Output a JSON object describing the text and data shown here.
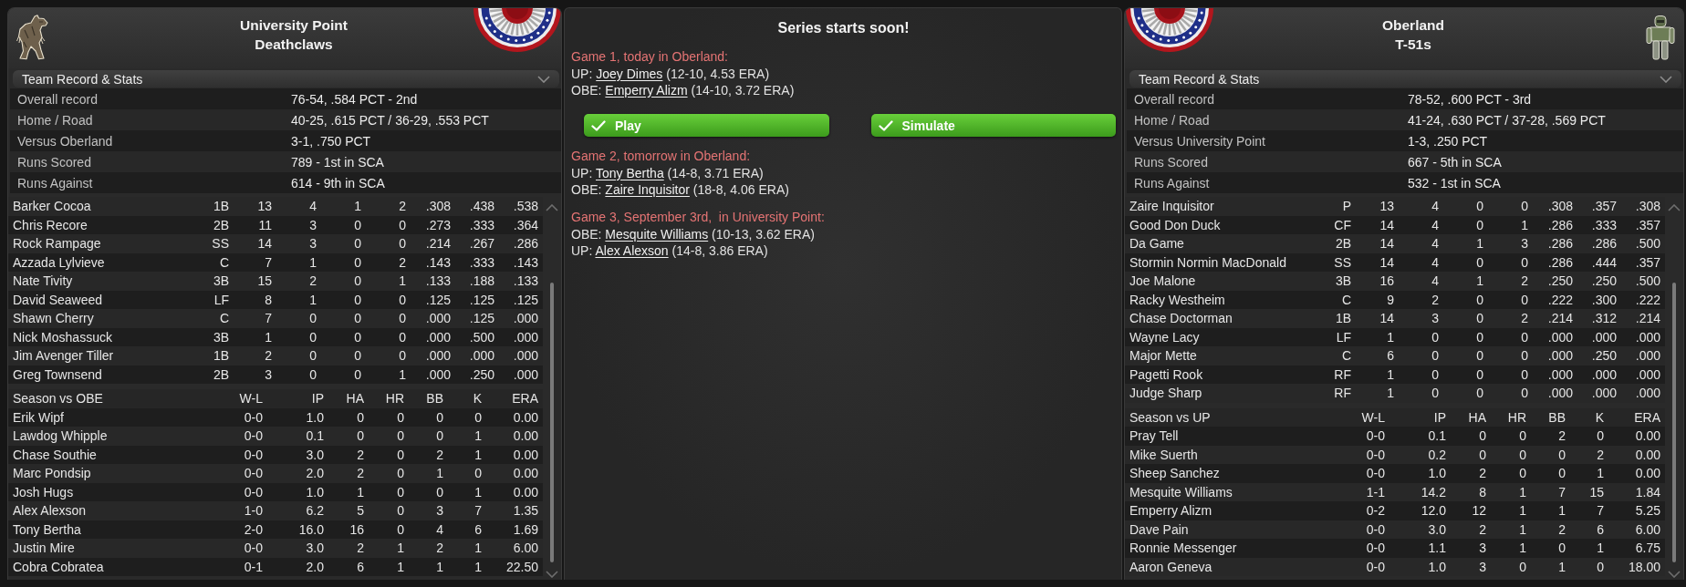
{
  "left_team_panel": {
    "title_lines": [
      "University Point",
      "Deathclaws"
    ],
    "record_section": {
      "title": "Team Record & Stats",
      "expanded": true,
      "rows": [
        {
          "label": "Overall record",
          "value": "76-54, .584 PCT - 2nd"
        },
        {
          "label": "Home / Road",
          "value": "40-25, .615 PCT / 36-29, .553 PCT"
        },
        {
          "label": "Versus Oberland",
          "value": "3-1, .750 PCT"
        },
        {
          "label": "Runs Scored",
          "value": "789 - 1st in SCA"
        },
        {
          "label": "Runs Against",
          "value": "614 - 9th in SCA"
        }
      ]
    },
    "player_tables": [
      {
        "rows": [
          [
            "Barker Cocoa",
            "1B",
            "13",
            "4",
            "1",
            "2",
            ".308",
            ".438",
            ".538"
          ],
          [
            "Chris Recore",
            "2B",
            "11",
            "3",
            "0",
            "0",
            ".273",
            ".333",
            ".364"
          ],
          [
            "Rock Rampage",
            "SS",
            "14",
            "3",
            "0",
            "0",
            ".214",
            ".267",
            ".286"
          ],
          [
            "Azzada Lylvieve",
            "C",
            "7",
            "1",
            "0",
            "2",
            ".143",
            ".333",
            ".143"
          ],
          [
            "Nate Tivity",
            "3B",
            "15",
            "2",
            "0",
            "1",
            ".133",
            ".188",
            ".133"
          ],
          [
            "David Seaweed",
            "LF",
            "8",
            "1",
            "0",
            "0",
            ".125",
            ".125",
            ".125"
          ],
          [
            "Shawn Cherry",
            "C",
            "7",
            "0",
            "0",
            "0",
            ".000",
            ".125",
            ".000"
          ],
          [
            "Nick Moshassuck",
            "3B",
            "1",
            "0",
            "0",
            "0",
            ".000",
            ".500",
            ".000"
          ],
          [
            "Jim Avenger Tiller",
            "1B",
            "2",
            "0",
            "0",
            "0",
            ".000",
            ".000",
            ".000"
          ],
          [
            "Greg Townsend",
            "2B",
            "3",
            "0",
            "0",
            "1",
            ".000",
            ".250",
            ".000"
          ]
        ]
      },
      {
        "columns": [
          "Season vs OBE",
          "W-L",
          "IP",
          "HA",
          "HR",
          "BB",
          "K",
          "ERA"
        ],
        "rows": [
          [
            "Erik Wipf",
            "0-0",
            "1.0",
            "0",
            "0",
            "0",
            "0",
            "0.00"
          ],
          [
            "Lawdog Whipple",
            "0-0",
            "0.1",
            "0",
            "0",
            "0",
            "1",
            "0.00"
          ],
          [
            "Chase Southie",
            "0-0",
            "3.0",
            "2",
            "0",
            "2",
            "1",
            "0.00"
          ],
          [
            "Marc Pondsip",
            "0-0",
            "2.0",
            "2",
            "0",
            "1",
            "0",
            "0.00"
          ],
          [
            "Josh Hugs",
            "0-0",
            "1.0",
            "1",
            "0",
            "0",
            "1",
            "0.00"
          ],
          [
            "Alex Alexson",
            "1-0",
            "6.2",
            "5",
            "0",
            "3",
            "7",
            "1.35"
          ],
          [
            "Tony Bertha",
            "2-0",
            "16.0",
            "16",
            "0",
            "4",
            "6",
            "1.69"
          ],
          [
            "Justin Mire",
            "0-0",
            "3.0",
            "2",
            "1",
            "2",
            "1",
            "6.00"
          ],
          [
            "Cobra Cobratea",
            "0-1",
            "2.0",
            "6",
            "1",
            "1",
            "1",
            "22.50"
          ]
        ]
      }
    ]
  },
  "series_panel": {
    "title": "Series starts soon!",
    "games": [
      {
        "heading": "Game 1, today in Oberland:",
        "starters": [
          {
            "team": "UP:",
            "pitcher": "Joey Dimes",
            "record": "(12-10, 4.53 ERA)"
          },
          {
            "team": "OBE:",
            "pitcher": "Emperry Alizm",
            "record": "(14-10, 3.72 ERA)"
          }
        ],
        "buttons": [
          "Play",
          "Simulate"
        ]
      },
      {
        "heading": "Game 2, tomorrow in Oberland:",
        "starters": [
          {
            "team": "UP:",
            "pitcher": "Tony Bertha",
            "record": "(14-8, 3.71 ERA)"
          },
          {
            "team": "OBE:",
            "pitcher": "Zaire Inquisitor",
            "record": "(18-8, 4.06 ERA)"
          }
        ]
      },
      {
        "heading": "Game 3, September 3rd,  in University Point:",
        "starters": [
          {
            "team": "OBE:",
            "pitcher": "Mesquite Williams",
            "record": "(10-13, 3.62 ERA)"
          },
          {
            "team": "UP:",
            "pitcher": "Alex Alexson",
            "record": "(14-8, 3.86 ERA)"
          }
        ]
      }
    ]
  },
  "right_team_panel": {
    "title_lines": [
      "Oberland",
      "T-51s"
    ],
    "record_section": {
      "title": "Team Record & Stats",
      "expanded": true,
      "rows": [
        {
          "label": "Overall record",
          "value": "78-52, .600 PCT - 3rd"
        },
        {
          "label": "Home / Road",
          "value": "41-24, .630 PCT / 37-28, .569 PCT"
        },
        {
          "label": "Versus University Point",
          "value": "1-3, .250 PCT"
        },
        {
          "label": "Runs Scored",
          "value": "667 - 5th in SCA"
        },
        {
          "label": "Runs Against",
          "value": "532 - 1st in SCA"
        }
      ]
    },
    "player_tables": [
      {
        "rows": [
          [
            "Zaire Inquisitor",
            "P",
            "13",
            "4",
            "0",
            "0",
            ".308",
            ".357",
            ".308"
          ],
          [
            "Good Don Duck",
            "CF",
            "14",
            "4",
            "0",
            "1",
            ".286",
            ".333",
            ".357"
          ],
          [
            "Da Game",
            "2B",
            "14",
            "4",
            "1",
            "3",
            ".286",
            ".286",
            ".500"
          ],
          [
            "Stormin Normin MacDonald",
            "SS",
            "14",
            "4",
            "0",
            "0",
            ".286",
            ".444",
            ".357"
          ],
          [
            "Joe Malone",
            "3B",
            "16",
            "4",
            "1",
            "2",
            ".250",
            ".250",
            ".500"
          ],
          [
            "Racky Westheim",
            "C",
            "9",
            "2",
            "0",
            "0",
            ".222",
            ".300",
            ".222"
          ],
          [
            "Chase Doctorman",
            "1B",
            "14",
            "3",
            "0",
            "2",
            ".214",
            ".312",
            ".214"
          ],
          [
            "Wayne Lacy",
            "LF",
            "1",
            "0",
            "0",
            "0",
            ".000",
            ".000",
            ".000"
          ],
          [
            "Major Mette",
            "C",
            "6",
            "0",
            "0",
            "0",
            ".000",
            ".250",
            ".000"
          ],
          [
            "Pagetti Rook",
            "RF",
            "1",
            "0",
            "0",
            "0",
            ".000",
            ".000",
            ".000"
          ],
          [
            "Judge Sharp",
            "RF",
            "1",
            "0",
            "0",
            "0",
            ".000",
            ".000",
            ".000"
          ]
        ]
      },
      {
        "columns": [
          "Season vs UP",
          "W-L",
          "IP",
          "HA",
          "HR",
          "BB",
          "K",
          "ERA"
        ],
        "rows": [
          [
            "Pray Tell",
            "0-0",
            "0.1",
            "0",
            "0",
            "2",
            "0",
            "0.00"
          ],
          [
            "Mike Suerth",
            "0-0",
            "0.2",
            "0",
            "0",
            "0",
            "2",
            "0.00"
          ],
          [
            "Sheep Sanchez",
            "0-0",
            "1.0",
            "2",
            "0",
            "0",
            "1",
            "0.00"
          ],
          [
            "Mesquite Williams",
            "1-1",
            "14.2",
            "8",
            "1",
            "7",
            "15",
            "1.84"
          ],
          [
            "Emperry Alizm",
            "0-2",
            "12.0",
            "12",
            "1",
            "1",
            "7",
            "5.25"
          ],
          [
            "Dave Pain",
            "0-0",
            "3.0",
            "2",
            "1",
            "2",
            "6",
            "6.00"
          ],
          [
            "Ronnie Messenger",
            "0-0",
            "1.1",
            "3",
            "1",
            "0",
            "1",
            "6.75"
          ],
          [
            "Aaron Geneva",
            "0-0",
            "1.0",
            "3",
            "0",
            "1",
            "0",
            "18.00"
          ]
        ]
      }
    ]
  }
}
